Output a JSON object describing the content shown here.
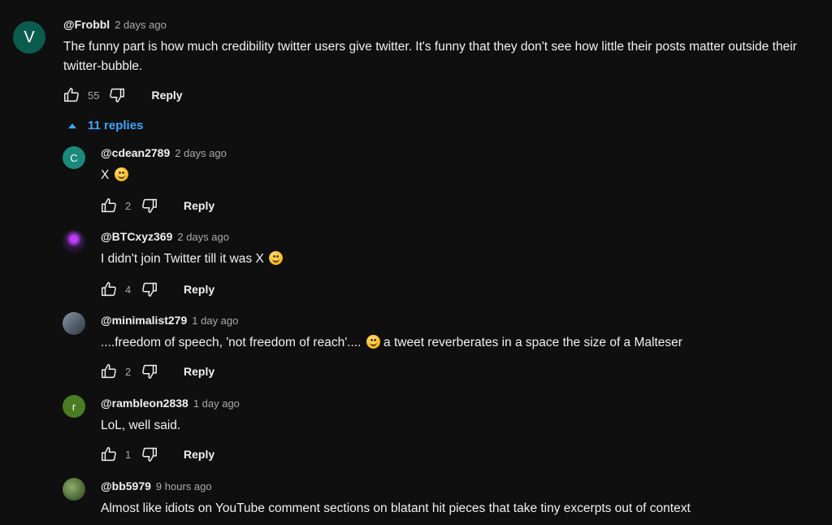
{
  "top_comment": {
    "avatar_letter": "V",
    "avatar_color": "#0b5b4e",
    "handle": "@Frobbl",
    "time": "2 days ago",
    "text": "The funny part is how much credibility twitter users give twitter. It's funny that they don't see how little their posts matter outside their twitter-bubble.",
    "likes": "55",
    "reply_label": "Reply"
  },
  "replies_toggle": {
    "label": "11 replies",
    "icon": "chevron-up-icon",
    "color": "#3ea6ff"
  },
  "replies": [
    {
      "handle": "@cdean2789",
      "time": "2 days ago",
      "avatar_letter": "C",
      "avatar_color": "#1a8a7a",
      "text": "X",
      "emoji": "laughing-tears-emoji",
      "likes": "2",
      "reply_label": "Reply"
    },
    {
      "handle": "@BTCxyz369",
      "time": "2 days ago",
      "avatar_letter": "",
      "avatar_color": "#2a1a3a",
      "text": "I didn't join Twitter till it was X",
      "emoji": "smiling-emoji",
      "likes": "4",
      "reply_label": "Reply"
    },
    {
      "handle": "@minimalist279",
      "time": "1 day ago",
      "avatar_letter": "",
      "avatar_color": "#6f7a86",
      "text": "....freedom of speech, 'not freedom of reach'....",
      "emoji": "winking-emoji",
      "text_after": " a tweet reverberates in a space the size of a Malteser",
      "likes": "2",
      "reply_label": "Reply"
    },
    {
      "handle": "@rambleon2838",
      "time": "1 day ago",
      "avatar_letter": "r",
      "avatar_color": "#4a7c23",
      "text": "LoL, well said.",
      "likes": "1",
      "reply_label": "Reply"
    },
    {
      "handle": "@bb5979",
      "time": "9 hours ago",
      "avatar_letter": "",
      "avatar_color": "#4f6b3a",
      "text": "Almost like idiots on YouTube comment sections on blatant hit pieces that take tiny excerpts out of context"
    }
  ]
}
